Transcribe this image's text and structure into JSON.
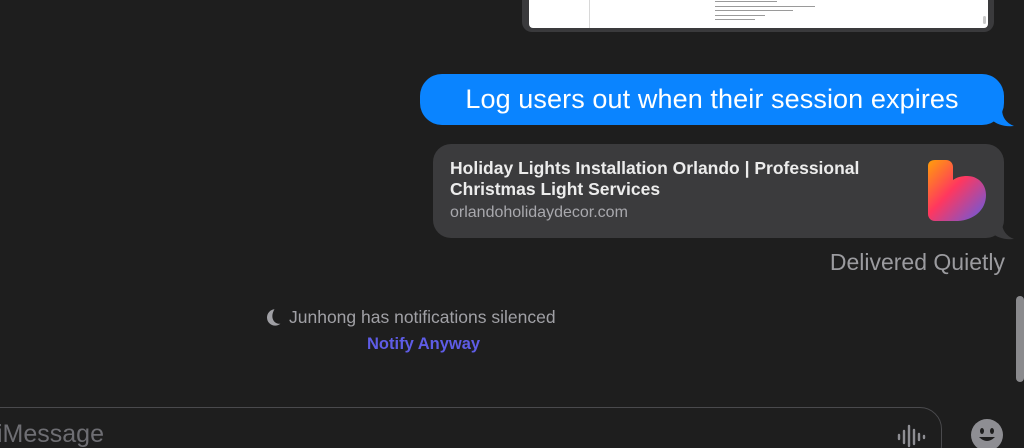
{
  "attachment": {
    "icon": "document-screenshot"
  },
  "message": {
    "text": "Log users out when their session expires",
    "bubble_color": "#0a84ff"
  },
  "link_preview": {
    "title": "Holiday Lights Installation Orlando | Professional Christmas Light Services",
    "domain": "orlandoholidaydecor.com",
    "icon": "heart-logo-icon"
  },
  "status": {
    "delivered": "Delivered Quietly"
  },
  "focus_notice": {
    "text": "Junhong has notifications silenced",
    "action": "Notify Anyway",
    "icon": "moon-icon",
    "action_color": "#5e5ce6"
  },
  "input": {
    "placeholder": "iMessage",
    "voice_icon": "waveform-icon",
    "emoji_icon": "emoji-icon"
  }
}
